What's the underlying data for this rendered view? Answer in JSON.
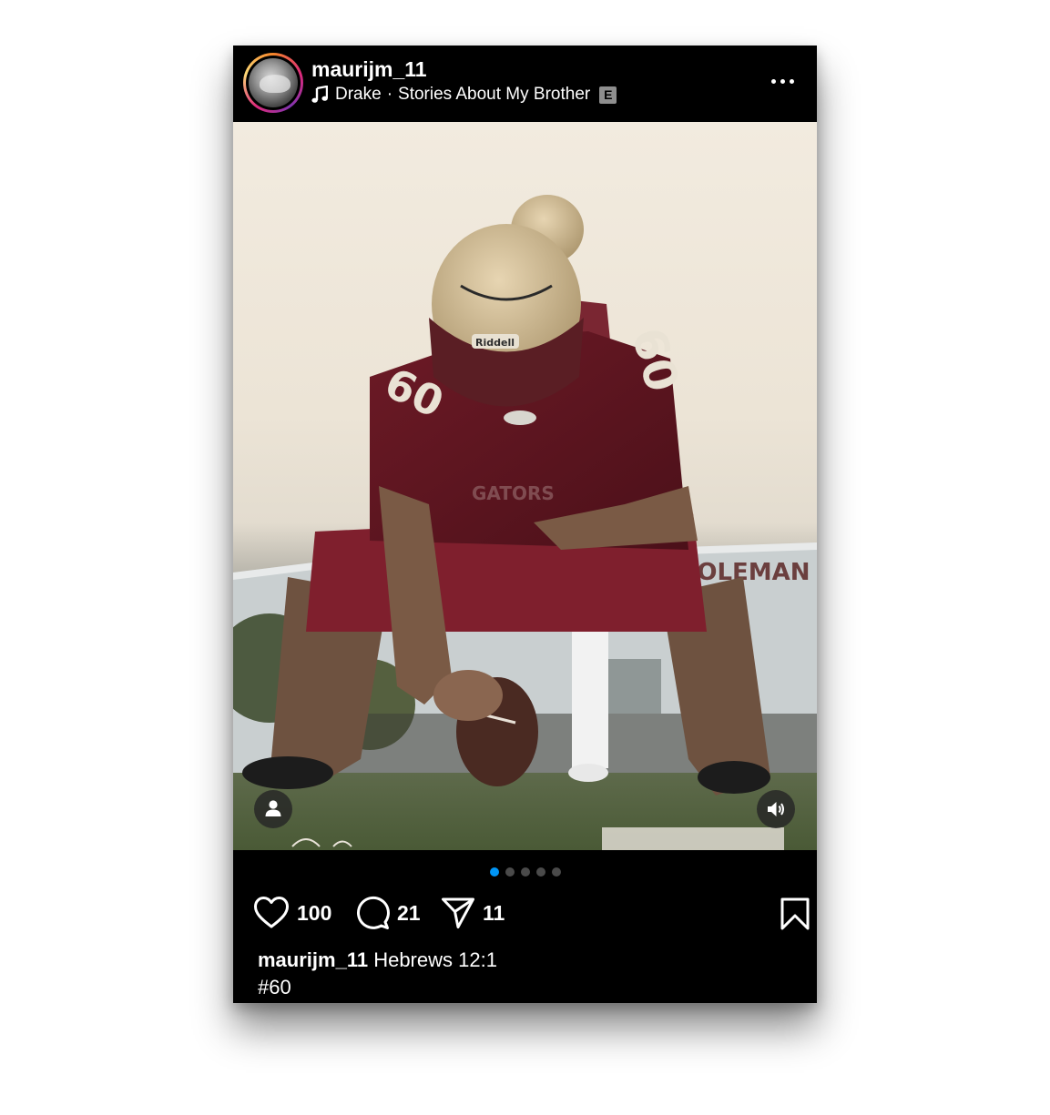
{
  "header": {
    "username": "maurijm_11",
    "music": {
      "artist": "Drake",
      "separator": "·",
      "song": "Stories About My Brother",
      "explicit_badge": "E"
    },
    "more_icon": "more-horizontal-icon"
  },
  "media": {
    "photo_text": {
      "jersey_number": "60",
      "building_sign": "GOLEMAN",
      "helmet_brand": "Riddell",
      "jersey_text": "GATORS"
    },
    "tag_icon": "person-icon",
    "sound_icon": "speaker-icon"
  },
  "carousel": {
    "total": 5,
    "active_index": 0,
    "active_color": "#0095f6"
  },
  "actions": {
    "likes": "100",
    "comments": "21",
    "shares": "11",
    "icons": [
      "heart-icon",
      "comment-icon",
      "send-icon",
      "bookmark-icon"
    ]
  },
  "caption": {
    "username": "maurijm_11",
    "text": "Hebrews 12:1",
    "hashtag": "#60"
  }
}
